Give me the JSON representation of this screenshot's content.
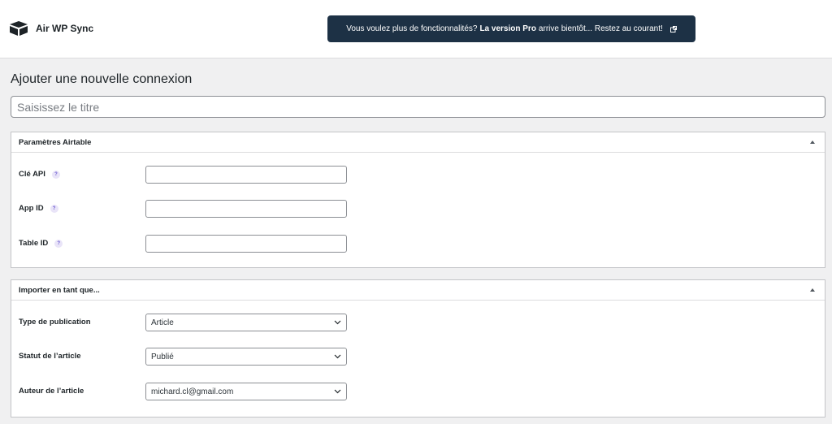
{
  "header": {
    "brand_name": "Air WP Sync",
    "promo": {
      "prefix": "Vous voulez plus de fonctionnalités?",
      "bold": "La version Pro",
      "suffix": "arrive bientôt... Restez au courant!"
    }
  },
  "page": {
    "title": "Ajouter une nouvelle connexion",
    "title_placeholder": "Saisissez le titre"
  },
  "airtable_box": {
    "title": "Paramètres Airtable",
    "fields": [
      {
        "label": "Clé API",
        "value": ""
      },
      {
        "label": "App ID",
        "value": ""
      },
      {
        "label": "Table ID",
        "value": ""
      }
    ],
    "help_glyph": "?"
  },
  "import_box": {
    "title": "Importer en tant que...",
    "fields": [
      {
        "label": "Type de publication",
        "value": "Article"
      },
      {
        "label": "Statut de l’article",
        "value": "Publié"
      },
      {
        "label": "Auteur de l’article",
        "value": "michard.cl@gmail.com"
      }
    ]
  }
}
